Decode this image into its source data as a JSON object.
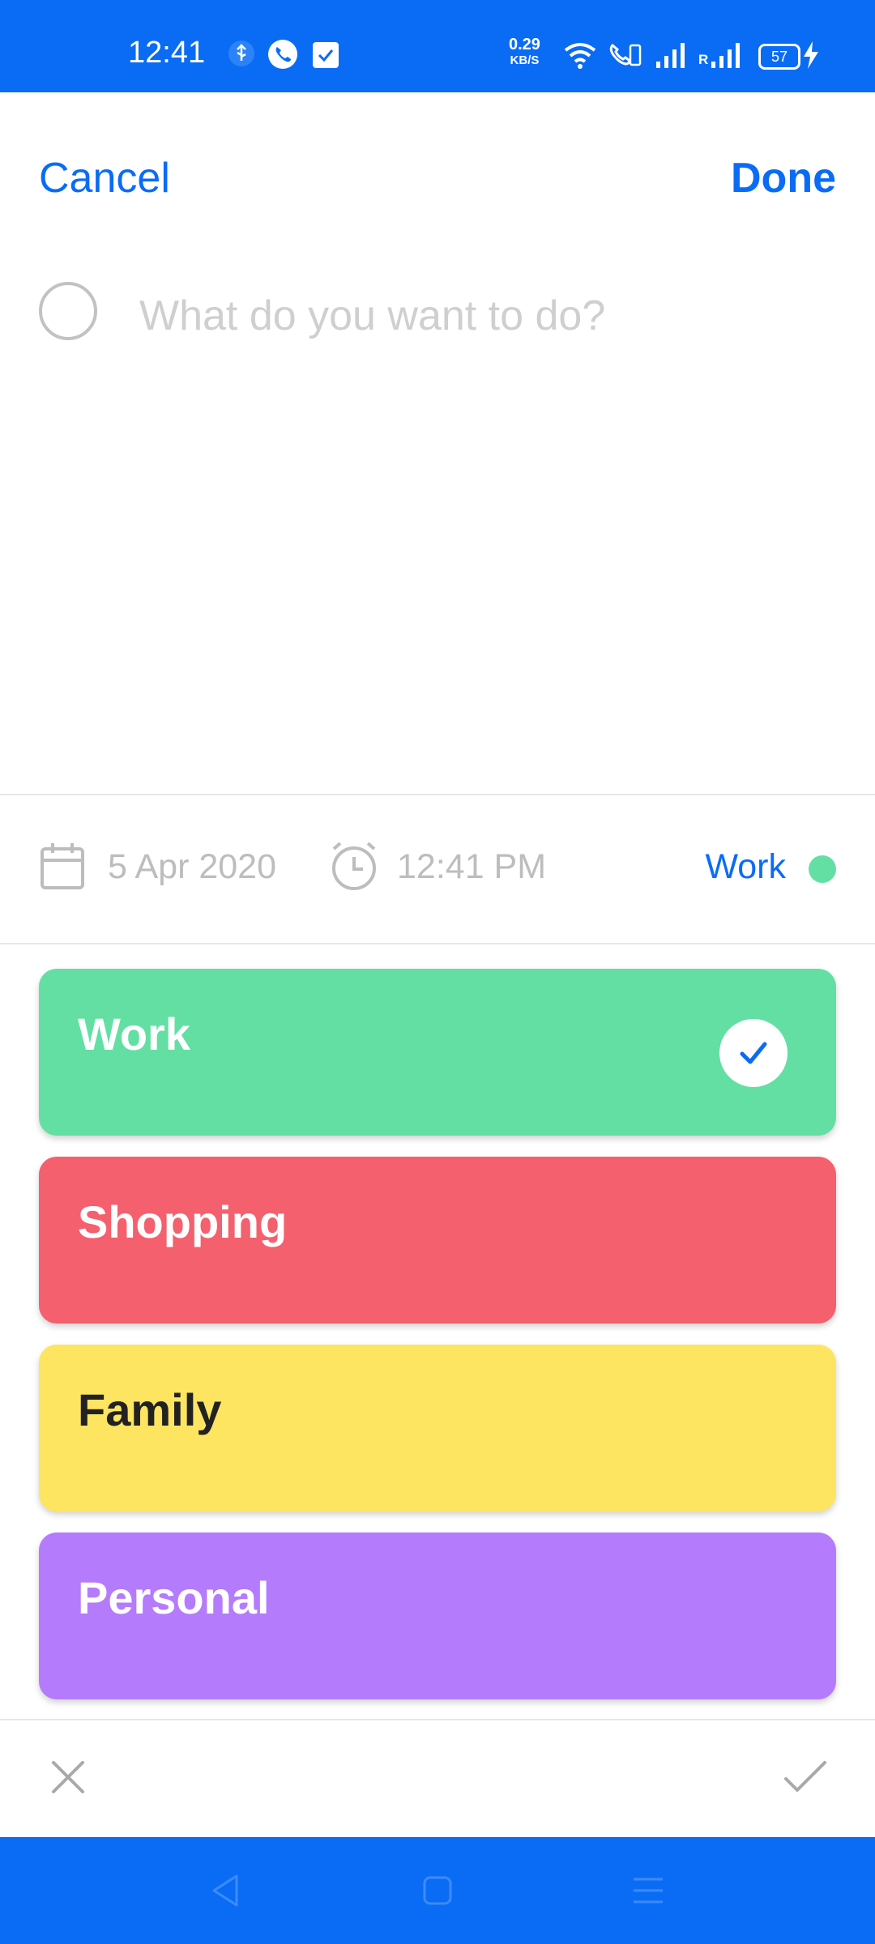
{
  "status_bar": {
    "time": "12:41",
    "speed_value": "0.29",
    "speed_unit": "KB/S",
    "battery": "57",
    "roaming_label": "R",
    "icons": [
      "usb-icon",
      "phone-icon",
      "check-notification-icon",
      "wifi-icon",
      "volte-call-icon",
      "signal-icon",
      "signal-roaming-icon",
      "battery-icon",
      "charging-icon"
    ]
  },
  "header": {
    "cancel_label": "Cancel",
    "done_label": "Done"
  },
  "task": {
    "placeholder": "What do you want to do?",
    "value": ""
  },
  "meta": {
    "date": "5 Apr 2020",
    "time": "12:41 PM",
    "category": "Work",
    "category_color": "#64dfa4"
  },
  "categories": [
    {
      "name": "Work",
      "color": "#64dfa4",
      "text_color": "#ffffff",
      "selected": true
    },
    {
      "name": "Shopping",
      "color": "#f4606e",
      "text_color": "#ffffff",
      "selected": false
    },
    {
      "name": "Family",
      "color": "#fde562",
      "text_color": "#222222",
      "selected": false
    },
    {
      "name": "Personal",
      "color": "#b57bfd",
      "text_color": "#ffffff",
      "selected": false
    }
  ],
  "colors": {
    "accent": "#0a6cf5",
    "icon_gray": "#bdbdbd"
  }
}
